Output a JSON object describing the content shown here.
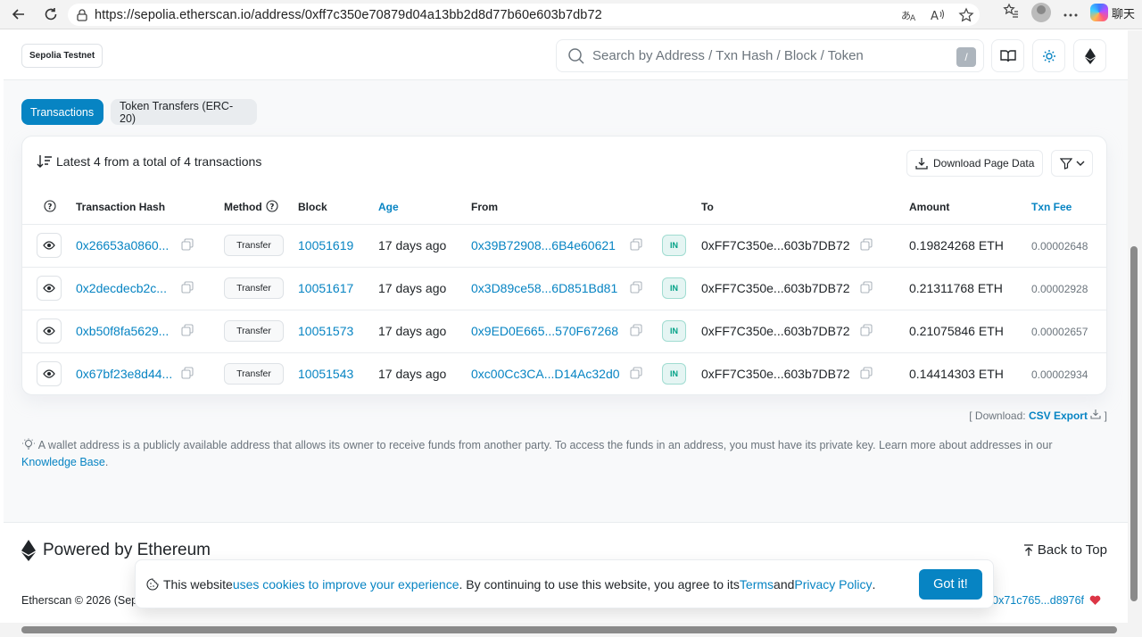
{
  "browser": {
    "url": "https://sepolia.etherscan.io/address/0xff7c350e70879d04a13bb2d8d77b60e603b7db72",
    "profile_label": "聊天"
  },
  "header": {
    "network": "Sepolia Testnet",
    "search_placeholder": "Search by Address / Txn Hash / Block / Token",
    "search_key": "/"
  },
  "tabs": [
    {
      "label": "Transactions",
      "active": true
    },
    {
      "label": "Token Transfers (ERC-20)",
      "active": false
    }
  ],
  "summary": "Latest 4 from a total of 4 transactions",
  "download_label": "Download Page Data",
  "columns": {
    "hash": "Transaction Hash",
    "method": "Method",
    "block": "Block",
    "age": "Age",
    "from": "From",
    "to": "To",
    "amount": "Amount",
    "fee": "Txn Fee"
  },
  "rows": [
    {
      "hash": "0x26653a0860...",
      "method": "Transfer",
      "block": "10051619",
      "age": "17 days ago",
      "from": "0x39B72908...6B4e60621",
      "dir": "IN",
      "to": "0xFF7C350e...603b7DB72",
      "amount": "0.19824268 ETH",
      "fee": "0.00002648"
    },
    {
      "hash": "0x2decdecb2c...",
      "method": "Transfer",
      "block": "10051617",
      "age": "17 days ago",
      "from": "0x3D89ce58...6D851Bd81",
      "dir": "IN",
      "to": "0xFF7C350e...603b7DB72",
      "amount": "0.21311768 ETH",
      "fee": "0.00002928"
    },
    {
      "hash": "0xb50f8fa5629...",
      "method": "Transfer",
      "block": "10051573",
      "age": "17 days ago",
      "from": "0x9ED0E665...570F67268",
      "dir": "IN",
      "to": "0xFF7C350e...603b7DB72",
      "amount": "0.21075846 ETH",
      "fee": "0.00002657"
    },
    {
      "hash": "0x67bf23e8d44...",
      "method": "Transfer",
      "block": "10051543",
      "age": "17 days ago",
      "from": "0xc00Cc3CA...D14Ac32d0",
      "dir": "IN",
      "to": "0xFF7C350e...603b7DB72",
      "amount": "0.14414303 ETH",
      "fee": "0.00002934"
    }
  ],
  "csv": {
    "prefix": "[ Download:",
    "link": "CSV Export",
    "suffix": "]"
  },
  "note": {
    "text": "A wallet address is a publicly available address that allows its owner to receive funds from another party. To access the funds in an address, you must have its private key. Learn more about addresses in our",
    "link": "Knowledge Base",
    "end": "."
  },
  "footer": {
    "powered": "Powered by Ethereum",
    "back_to_top": "Back to Top",
    "copyright": "Etherscan © 2026 (Sep",
    "donate": "0x71c765...d8976f"
  },
  "cookie": {
    "t1": "This website ",
    "l1": "uses cookies to improve your experience",
    "t2": ". By continuing to use this website, you agree to its ",
    "l2": "Terms",
    "t3": " and ",
    "l3": "Privacy Policy",
    "t4": ".",
    "button": "Got it!"
  },
  "colors": {
    "accent": "#0784c3",
    "in_badge": "#00a186"
  }
}
